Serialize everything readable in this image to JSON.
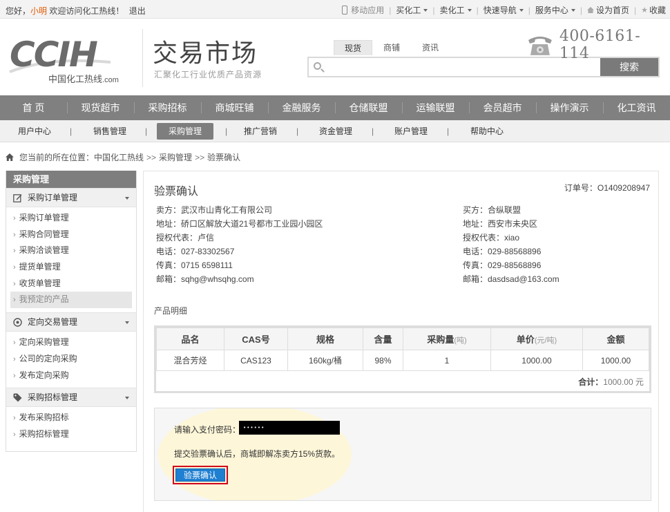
{
  "topbar": {
    "greeting": "您好，",
    "username": "小明",
    "welcome": "欢迎访问化工热线！",
    "logout": "退出",
    "links": [
      {
        "label": "移动应用",
        "icon": "mobile-phone-icon"
      },
      {
        "label": "买化工",
        "dropdown": true
      },
      {
        "label": "卖化工",
        "dropdown": true
      },
      {
        "label": "快速导航",
        "dropdown": true
      },
      {
        "label": "服务中心",
        "dropdown": true
      },
      {
        "label": "设为首页",
        "icon": "home-icon"
      },
      {
        "label": "收藏",
        "icon": "star-icon"
      }
    ]
  },
  "header": {
    "logo_main": "CCIH",
    "logo_sub": "中国化工热线",
    "logo_domain": ".com",
    "market_title": "交易市场",
    "market_subtitle": "汇聚化工行业优质产品资源",
    "search_tabs": [
      "现货",
      "商铺",
      "资讯"
    ],
    "search_active_tab": "现货",
    "search_value": "",
    "search_button": "搜索",
    "hotline": "400-6161-114"
  },
  "main_nav": [
    "首 页",
    "现货超市",
    "采购招标",
    "商城旺铺",
    "金融服务",
    "仓储联盟",
    "运输联盟",
    "会员超市",
    "操作演示",
    "化工资讯"
  ],
  "sub_nav": {
    "items": [
      "用户中心",
      "销售管理",
      "采购管理",
      "推广营销",
      "资金管理",
      "账户管理",
      "帮助中心"
    ],
    "active": "采购管理"
  },
  "breadcrumb": {
    "prefix": "您当前的所在位置：",
    "items": [
      "中国化工热线",
      "采购管理",
      "验票确认"
    ],
    "separator": ">>"
  },
  "sidebar": {
    "title": "采购管理",
    "groups": [
      {
        "label": "采购订单管理",
        "icon": "edit-icon",
        "items": [
          "采购订单管理",
          "采购合同管理",
          "采购洽谈管理",
          "提货单管理",
          "收货单管理",
          "我预定的产品"
        ]
      },
      {
        "label": "定向交易管理",
        "icon": "target-icon",
        "items": [
          "定向采购管理",
          "公司的定向采购",
          "发布定向采购"
        ]
      },
      {
        "label": "采购招标管理",
        "icon": "tag-icon",
        "items": [
          "发布采购招标",
          "采购招标管理"
        ]
      }
    ],
    "active_item": "我预定的产品"
  },
  "content": {
    "title": "验票确认",
    "order_label": "订单号：",
    "order_no": "O1409208947",
    "seller": {
      "party": "卖方：武汉市山青化工有限公司",
      "address": "地址：硚口区解放大道21号都市工业园小园区",
      "rep": "授权代表：卢信",
      "phone": "电话：027-83302567",
      "fax": "传真：0715 6598111",
      "email": "邮箱：sqhg@whsqhg.com"
    },
    "buyer": {
      "party": "买方：合纵联盟",
      "address": "地址：西安市未央区",
      "rep": "授权代表：xiao",
      "phone": "电话：029-88568896",
      "fax": "传真：029-88568896",
      "email": "邮箱：dasdsad@163.com"
    },
    "detail_label": "产品明细",
    "table": {
      "headers": [
        {
          "text": "品名",
          "unit": ""
        },
        {
          "text": "CAS号",
          "unit": ""
        },
        {
          "text": "规格",
          "unit": ""
        },
        {
          "text": "含量",
          "unit": ""
        },
        {
          "text": "采购量",
          "unit": "(吨)"
        },
        {
          "text": "单价",
          "unit": "(元/吨)"
        },
        {
          "text": "金额",
          "unit": ""
        }
      ],
      "rows": [
        [
          "混合芳烃",
          "CAS123",
          "160kg/桶",
          "98%",
          "1",
          "1000.00",
          "1000.00"
        ]
      ],
      "total_label": "合计：",
      "total_amount": "1000.00 元"
    },
    "payment": {
      "label": "请输入支付密码：",
      "password_mask": "••••••",
      "note": "提交验票确认后，商城即解冻卖方15%货款。",
      "confirm_button": "验票确认"
    }
  },
  "colors": {
    "nav_gray": "#808080",
    "username_orange": "#e05a00",
    "confirm_blue": "#1f7fd1",
    "highlight_red": "#d0021b",
    "glow_yellow": "#fdf6d8"
  }
}
